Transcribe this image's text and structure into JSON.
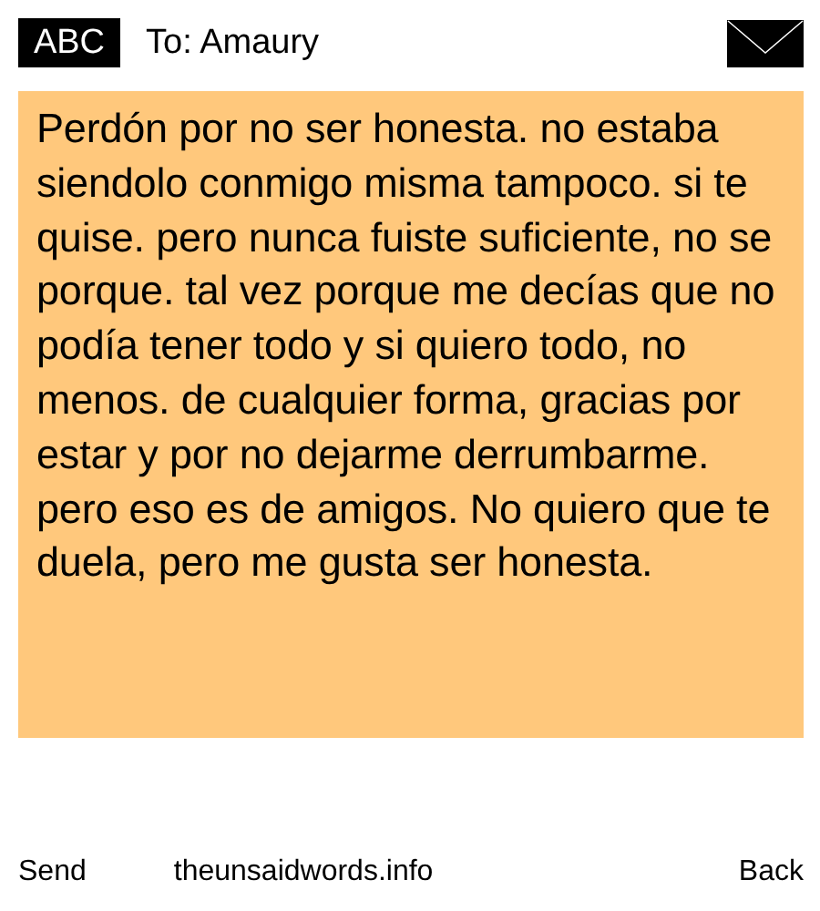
{
  "header": {
    "mode_badge": "ABC",
    "recipient": "To: Amaury"
  },
  "message": {
    "text": "Perdón por no ser honesta. no estaba siendolo conmigo misma tampoco. si te quise. pero nunca fuiste suficiente, no se porque. tal vez porque me decías que no podía tener todo y si quiero todo, no menos. de cualquier forma, gracias por estar y por no dejarme derrumbarme. pero eso es de amigos. No quiero que te duela, pero me gusta ser honesta."
  },
  "footer": {
    "left": "Send",
    "center": "theunsaidwords.info",
    "right": "Back"
  }
}
